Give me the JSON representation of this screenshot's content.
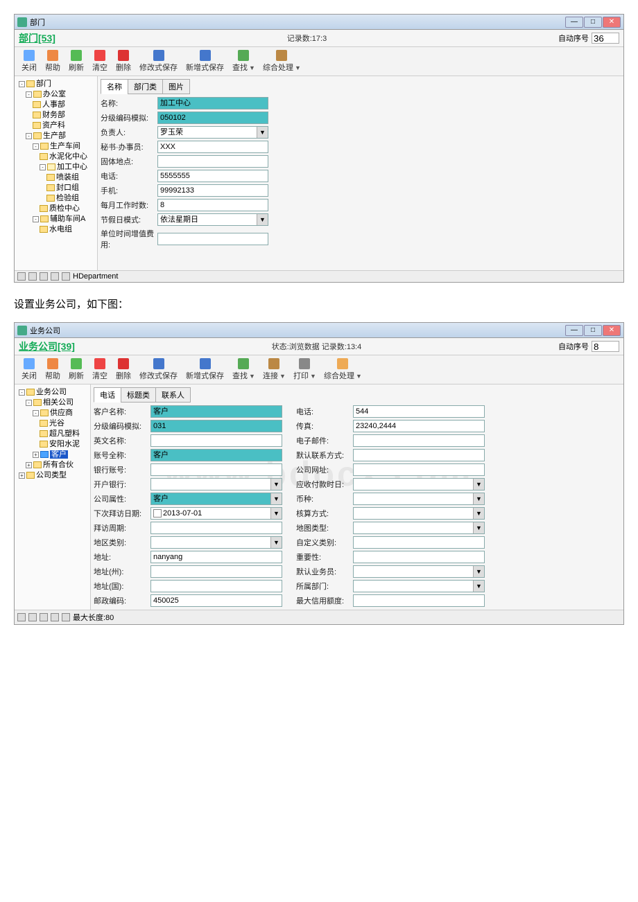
{
  "win1": {
    "title": "部门",
    "main_title": "部门[53]",
    "record": "记录数:17:3",
    "auto_label": "自动序号",
    "auto_val": "36",
    "toolbar": [
      "关闭",
      "帮助",
      "刷新",
      "清空",
      "删除",
      "修改式保存",
      "新增式保存",
      "查找",
      "综合处理"
    ],
    "tree": [
      {
        "l": 1,
        "t": "部门",
        "pm": "-"
      },
      {
        "l": 2,
        "t": "办公室",
        "pm": "-"
      },
      {
        "l": 3,
        "t": "人事部"
      },
      {
        "l": 3,
        "t": "财务部"
      },
      {
        "l": 3,
        "t": "资产科"
      },
      {
        "l": 2,
        "t": "生产部",
        "pm": "-"
      },
      {
        "l": 3,
        "t": "生产车间",
        "pm": "-"
      },
      {
        "l": 4,
        "t": "水泥化中心"
      },
      {
        "l": 4,
        "t": "加工中心",
        "pm": "-",
        "open": true
      },
      {
        "l": 5,
        "t": "喷装组"
      },
      {
        "l": 5,
        "t": "封口组"
      },
      {
        "l": 5,
        "t": "检验组"
      },
      {
        "l": 4,
        "t": "质检中心"
      },
      {
        "l": 3,
        "t": "辅助车间A",
        "pm": "-"
      },
      {
        "l": 4,
        "t": "水电组"
      }
    ],
    "tabs": [
      "名称",
      "部门类",
      "图片"
    ],
    "fields": [
      {
        "label": "名称:",
        "value": "加工中心",
        "hl": true
      },
      {
        "label": "分级编码模拟:",
        "value": "050102",
        "hl": true
      },
      {
        "label": "负责人:",
        "value": "罗玉荣",
        "dd": true
      },
      {
        "label": "秘书·办事员:",
        "value": "XXX"
      },
      {
        "label": "固体地点:",
        "value": ""
      },
      {
        "label": "电话:",
        "value": "5555555"
      },
      {
        "label": "手机:",
        "value": "99992133"
      },
      {
        "label": "每月工作时数:",
        "value": "8"
      },
      {
        "label": "节假日模式:",
        "value": "依法星期日",
        "dd": true
      },
      {
        "label": "单位时间增值费用:",
        "value": ""
      }
    ],
    "status": "HDepartment"
  },
  "caption": "设置业务公司，如下图：",
  "win2": {
    "title": "业务公司",
    "main_title": "业务公司[39]",
    "record": "状态:浏览数据 记录数:13:4",
    "auto_label": "自动序号",
    "auto_val": "8",
    "toolbar": [
      "关闭",
      "帮助",
      "刷新",
      "清空",
      "删除",
      "修改式保存",
      "新增式保存",
      "查找",
      "连接",
      "打印",
      "综合处理"
    ],
    "tree": [
      {
        "l": 1,
        "t": "业务公司",
        "pm": "-"
      },
      {
        "l": 2,
        "t": "相关公司",
        "pm": "-"
      },
      {
        "l": 3,
        "t": "供应商",
        "pm": "-"
      },
      {
        "l": 4,
        "t": "光谷"
      },
      {
        "l": 4,
        "t": "超凡塑料"
      },
      {
        "l": 4,
        "t": "安阳水泥"
      },
      {
        "l": 3,
        "t": "客户",
        "pm": "+",
        "sel": true
      },
      {
        "l": 2,
        "t": "所有合伙",
        "pm": "+"
      },
      {
        "l": 1,
        "t": "公司类型",
        "pm": "+"
      }
    ],
    "tabs": [
      "电话",
      "标题类",
      "联系人"
    ],
    "left_fields": [
      {
        "label": "客户名称:",
        "value": "客户",
        "hl": true
      },
      {
        "label": "分级编码模拟:",
        "value": "031",
        "hl": true
      },
      {
        "label": "英文名称:",
        "value": ""
      },
      {
        "label": "账号全称:",
        "value": "客户",
        "hl": true
      },
      {
        "label": "银行账号:",
        "value": ""
      },
      {
        "label": "开户银行:",
        "value": "",
        "dd": true
      },
      {
        "label": "公司属性:",
        "value": "客户",
        "hl": true,
        "dd": true
      },
      {
        "label": "下次拜访日期:",
        "value": "2013-07-01",
        "dd": true,
        "chk": true
      },
      {
        "label": "拜访周期:",
        "value": ""
      },
      {
        "label": "地区类别:",
        "value": "",
        "dd": true
      },
      {
        "label": "地址:",
        "value": "nanyang"
      },
      {
        "label": "地址(州):",
        "value": ""
      },
      {
        "label": "地址(国):",
        "value": ""
      },
      {
        "label": "邮政编码:",
        "value": "450025"
      }
    ],
    "right_fields": [
      {
        "label": "电话:",
        "value": "544"
      },
      {
        "label": "传真:",
        "value": "23240,2444"
      },
      {
        "label": "电子邮件:",
        "value": ""
      },
      {
        "label": "默认联系方式:",
        "value": ""
      },
      {
        "label": "公司网址:",
        "value": ""
      },
      {
        "label": "应收付款时日:",
        "value": "",
        "dd": true
      },
      {
        "label": "币种:",
        "value": "",
        "dd": true
      },
      {
        "label": "核算方式:",
        "value": "",
        "dd": true
      },
      {
        "label": "地图类型:",
        "value": "",
        "dd": true
      },
      {
        "label": "自定义类别:",
        "value": ""
      },
      {
        "label": "重要性:",
        "value": ""
      },
      {
        "label": "默认业务员:",
        "value": "",
        "dd": true
      },
      {
        "label": "所属部门:",
        "value": "",
        "dd": true
      },
      {
        "label": "最大信用额度:",
        "value": ""
      }
    ],
    "status": "最大长度:80",
    "watermark": "www.bdocx.com"
  }
}
